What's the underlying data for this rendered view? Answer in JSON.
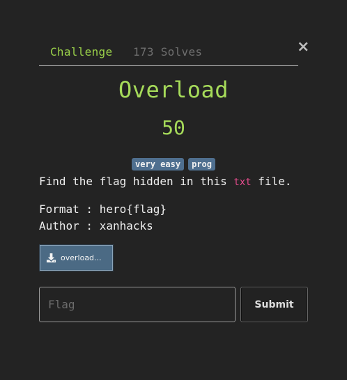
{
  "tabs": {
    "challenge": "Challenge",
    "solves": "173 Solves"
  },
  "close_label": "×",
  "challenge": {
    "name": "Overload",
    "points": "50",
    "tags": [
      "very easy",
      "prog"
    ],
    "description": {
      "before": "Find the flag hidden in this ",
      "code": "txt",
      "after": " file."
    },
    "format_line": "Format : hero{flag}",
    "author_line": "Author : xanhacks",
    "file": {
      "label": "overload...",
      "icon": "download-icon"
    }
  },
  "form": {
    "flag_placeholder": "Flag",
    "flag_value": "",
    "submit_label": "Submit"
  },
  "colors": {
    "accent": "#a6db5a",
    "tag_bg": "#4f6f8f",
    "code": "#e64c8d",
    "background": "#232323"
  }
}
